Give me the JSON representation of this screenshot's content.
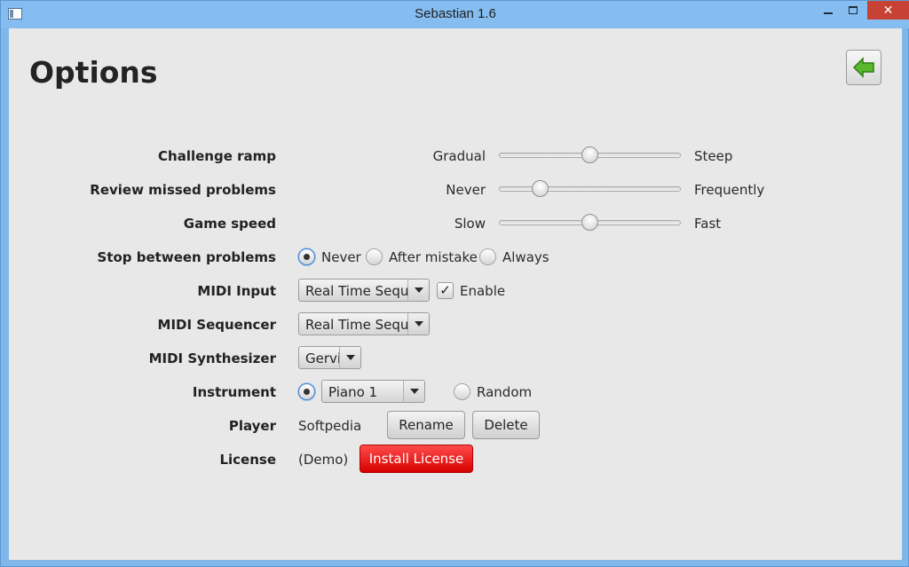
{
  "window": {
    "title": "Sebastian 1.6",
    "close_symbol": "✕"
  },
  "header": {
    "title": "Options"
  },
  "options": {
    "challenge_ramp": {
      "label": "Challenge ramp",
      "min_label": "Gradual",
      "max_label": "Steep",
      "value": 0.5
    },
    "review_missed": {
      "label": "Review missed problems",
      "min_label": "Never",
      "max_label": "Frequently",
      "value": 0.2
    },
    "game_speed": {
      "label": "Game speed",
      "min_label": "Slow",
      "max_label": "Fast",
      "value": 0.5
    },
    "stop_between": {
      "label": "Stop between problems",
      "choices": [
        "Never",
        "After mistake",
        "Always"
      ],
      "selected": "Never"
    },
    "midi_input": {
      "label": "MIDI Input",
      "selected": "Real Time Seque",
      "enable_label": "Enable",
      "enabled": true
    },
    "midi_sequencer": {
      "label": "MIDI Sequencer",
      "selected": "Real Time Seque"
    },
    "midi_synthesizer": {
      "label": "MIDI Synthesizer",
      "selected": "Gervil"
    },
    "instrument": {
      "label": "Instrument",
      "selected": "Piano 1",
      "random_label": "Random",
      "mode": "fixed"
    },
    "player": {
      "label": "Player",
      "name": "Softpedia",
      "rename_label": "Rename",
      "delete_label": "Delete"
    },
    "license": {
      "label": "License",
      "status": "(Demo)",
      "install_label": "Install License"
    }
  },
  "colors": {
    "accent_blue": "#3b7dc9",
    "install_red": "#e60000",
    "back_arrow_green": "#59b82b"
  },
  "icons": {
    "back": "arrow-left-icon"
  }
}
